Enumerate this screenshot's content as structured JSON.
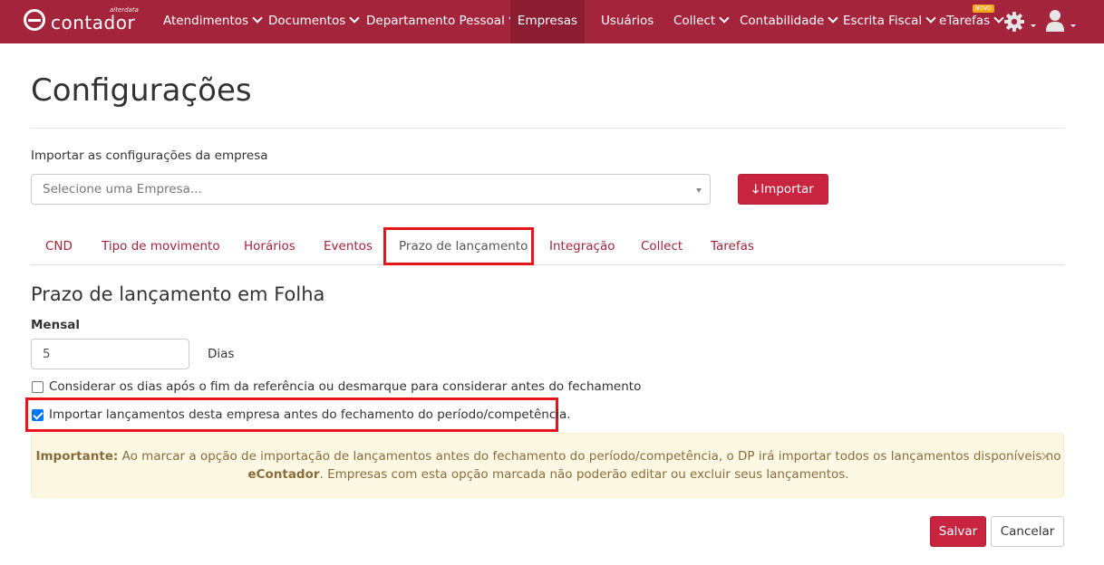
{
  "brand": {
    "name": "contador",
    "sub": "alterdata"
  },
  "nav": {
    "items": [
      {
        "label": "Atendimentos",
        "caret": true
      },
      {
        "label": "Documentos",
        "caret": true
      },
      {
        "label": "Departamento Pessoal",
        "caret": true
      },
      {
        "label": "Empresas",
        "caret": false,
        "active": true
      },
      {
        "label": "Usuários",
        "caret": false
      },
      {
        "label": "Collect",
        "caret": true
      },
      {
        "label": "Contabilidade",
        "caret": true
      },
      {
        "label": "Escrita Fiscal",
        "caret": true
      },
      {
        "label": "eTarefas",
        "caret": true
      }
    ],
    "novo_badge": "NOVO",
    "settings_icon": "gear-icon",
    "user_icon": "user-icon"
  },
  "page": {
    "title": "Configurações"
  },
  "import": {
    "label": "Importar as configurações da empresa",
    "placeholder": "Selecione uma Empresa...",
    "button_label": "Importar"
  },
  "tabs": [
    {
      "label": "CND"
    },
    {
      "label": "Tipo de movimento"
    },
    {
      "label": "Horários"
    },
    {
      "label": "Eventos"
    },
    {
      "label": "Prazo de lançamento",
      "active": true
    },
    {
      "label": "Integração"
    },
    {
      "label": "Collect"
    },
    {
      "label": "Tarefas"
    }
  ],
  "section": {
    "title": "Prazo de lançamento em Folha",
    "mensal_label": "Mensal",
    "dias_value": "5",
    "dias_label": "Dias",
    "checkbox1_label": "Considerar os dias após o fim da referência ou desmarque para considerar antes do fechamento",
    "checkbox1_checked": false,
    "checkbox2_label": "Importar lançamentos desta empresa antes do fechamento do período/competência.",
    "checkbox2_checked": true
  },
  "alert": {
    "strong1": "Importante:",
    "text1": " Ao marcar a opção de importação de lançamentos antes do fechamento do período/competência, o DP irá importar todos os lançamentos disponíveis no",
    "strong2": "eContador",
    "text2": ". Empresas com esta opção marcada não poderão editar ou excluir seus lançamentos.",
    "close": "×"
  },
  "actions": {
    "save_label": "Salvar",
    "cancel_label": "Cancelar"
  },
  "colors": {
    "navbar": "#a3243b",
    "primary_button": "#c9243f",
    "highlight": "#e8131c",
    "alert_bg": "#fcf8e3"
  }
}
